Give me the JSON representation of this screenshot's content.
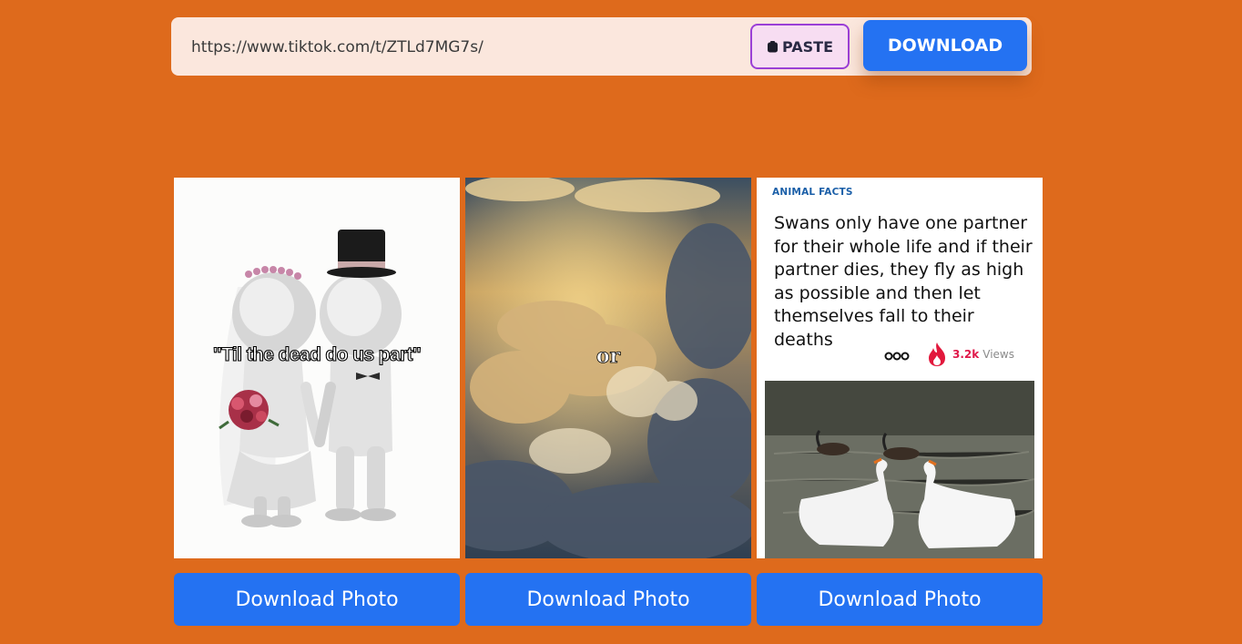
{
  "search": {
    "url_value": "https://www.tiktok.com/t/ZTLd7MG7s/",
    "paste_label": "PASTE",
    "download_label": "DOWNLOAD"
  },
  "cards": [
    {
      "caption": "\"Til the dead do us part\"",
      "button_label": "Download Photo"
    },
    {
      "caption": "or",
      "button_label": "Download Photo"
    },
    {
      "tag": "ANIMAL FACTS",
      "text_lines": [
        "Swans only have one partner",
        "for their whole life and if their",
        "partner dies, they fly as high",
        "as possible and then let",
        "themselves fall to their deaths"
      ],
      "views_count": "3.2k",
      "views_label": "Views",
      "button_label": "Download Photo"
    }
  ],
  "colors": {
    "background": "#de6a1c",
    "accent": "#2472f2"
  }
}
